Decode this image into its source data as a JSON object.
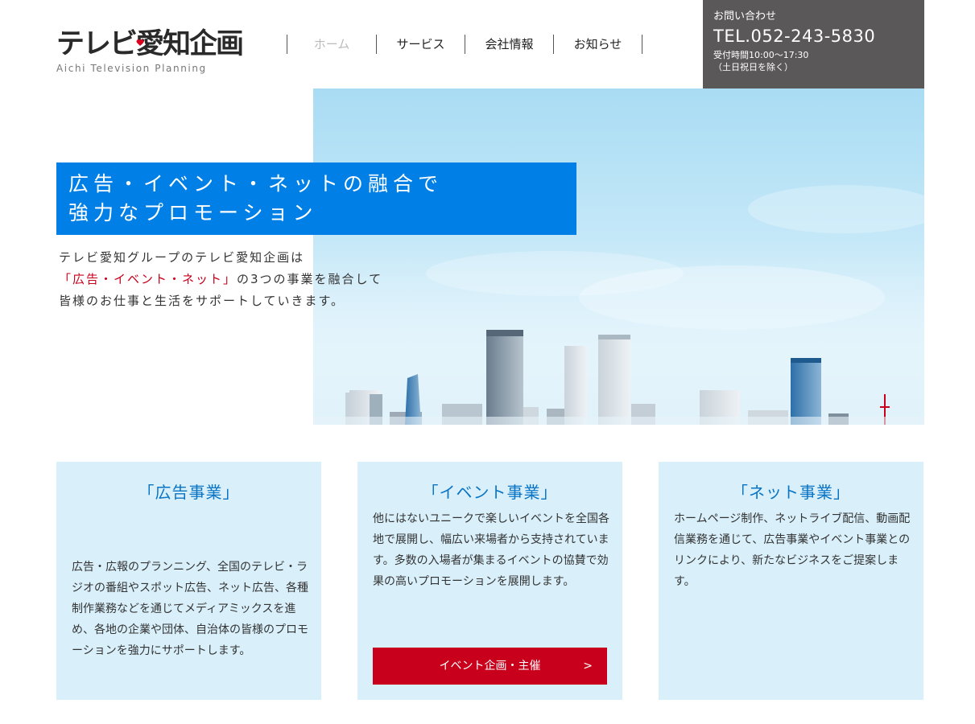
{
  "header": {
    "logo_main": "テレビ愛知企画",
    "logo_sub": "Aichi Television Planning"
  },
  "nav": [
    {
      "label": "ホーム",
      "active": true
    },
    {
      "label": "サービス",
      "active": false
    },
    {
      "label": "会社情報",
      "active": false
    },
    {
      "label": "お知らせ",
      "active": false
    }
  ],
  "contact": {
    "label": "お問い合わせ",
    "tel": "TEL.052-243-5830",
    "hours": "受付時間10:00～17:30",
    "note": "（土日祝日を除く）"
  },
  "hero": {
    "headline_1": "広告・イベント・ネットの融合で",
    "headline_2": "強力なプロモーション",
    "text_1": "テレビ愛知グループのテレビ愛知企画は",
    "text_2_red": "「広告・イベント・ネット」",
    "text_2_rest": "の3つの事業を融合して",
    "text_3": "皆様のお仕事と生活をサポートしていきます。"
  },
  "cards": [
    {
      "title": "「広告事業」",
      "body": "広告・広報のプランニング、全国のテレビ・ラジオの番組やスポット広告、ネット広告、各種制作業務などを通じてメディアミックスを進め、各地の企業や団体、自治体の皆様のプロモーションを強力にサポートします。"
    },
    {
      "title": "「イベント事業」",
      "body": "他にはないユニークで楽しいイベントを全国各地で展開し、幅広い来場者から支持されています。多数の入場者が集まるイベントの協賛で効果の高いプロモーションを展開します。",
      "button_label": "イベント企画・主催",
      "button_arrow": ">"
    },
    {
      "title": "「ネット事業」",
      "body": "ホームページ制作、ネットライブ配信、動画配信業務を通じて、広告事業やイベント事業とのリンクにより、新たなビジネスをご提案します。"
    }
  ],
  "colors": {
    "accent_blue": "#0080e6",
    "card_bg": "#d9f0fb",
    "card_title": "#0a74c4",
    "button_red": "#c8001c",
    "contact_bg": "#5a5858"
  }
}
